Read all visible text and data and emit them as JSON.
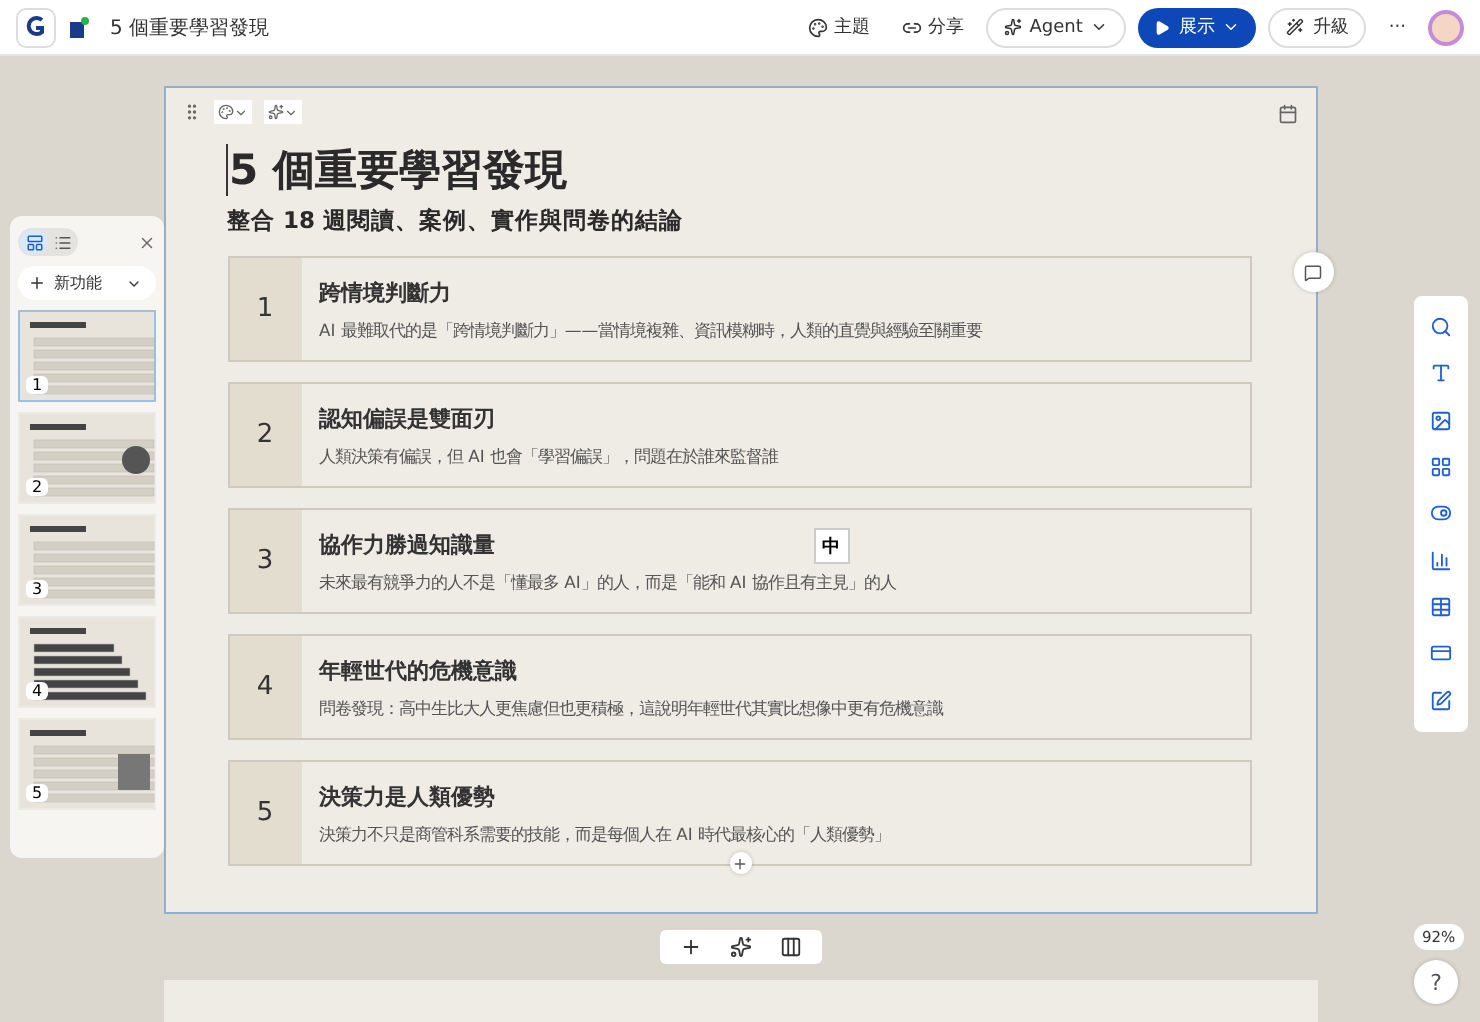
{
  "topbar": {
    "doc_title": "5 個重要學習發現",
    "theme": "主題",
    "share": "分享",
    "agent": "Agent",
    "present": "展示",
    "upgrade": "升級",
    "more": "···"
  },
  "panel": {
    "tabs": [
      {
        "kind": "grid",
        "selected": true
      },
      {
        "kind": "list",
        "selected": false
      }
    ],
    "new_feature": "新功能",
    "slides": [
      {
        "number": "1",
        "selected": true
      },
      {
        "number": "2",
        "selected": false
      },
      {
        "number": "3",
        "selected": false
      },
      {
        "number": "4",
        "selected": false
      },
      {
        "number": "5",
        "selected": false
      }
    ]
  },
  "slide": {
    "title": "5 個重要學習發現",
    "subtitle": "整合 18 週閱讀、案例、實作與問卷的結論",
    "items": [
      {
        "number": "1",
        "heading": "跨情境判斷力",
        "text": "AI 最難取代的是「跨情境判斷力」——當情境複雜、資訊模糊時，人類的直覺與經驗至關重要"
      },
      {
        "number": "2",
        "heading": "認知偏誤是雙面刃",
        "text": "人類決策有偏誤，但 AI 也會「學習偏誤」，問題在於誰來監督誰"
      },
      {
        "number": "3",
        "heading": "協作力勝過知識量",
        "text": "未來最有競爭力的人不是「懂最多 AI」的人，而是「能和 AI 協作且有主見」的人"
      },
      {
        "number": "4",
        "heading": "年輕世代的危機意識",
        "text": "問卷發現：高中生比大人更焦慮但也更積極，這說明年輕世代其實比想像中更有危機意識"
      },
      {
        "number": "5",
        "heading": "決策力是人類優勢",
        "text": "決策力不只是商管科系需要的技能，而是每個人在 AI 時代最核心的「人類優勢」"
      }
    ],
    "ime_indicator": "中"
  },
  "zoom": "92%",
  "help": "?"
}
